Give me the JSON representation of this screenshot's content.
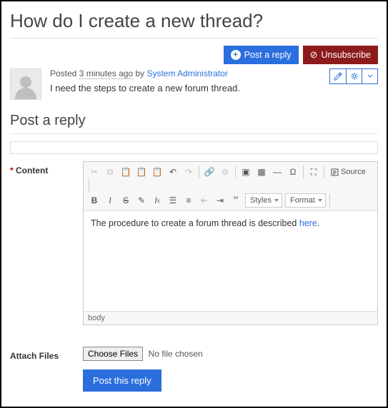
{
  "title": "How do I create a new thread?",
  "actions": {
    "post_reply": "Post a reply",
    "unsubscribe": "Unsubscribe"
  },
  "post": {
    "meta_prefix": "Posted",
    "timestamp": "3 minutes ago",
    "meta_by": "by",
    "author": "System Administrator",
    "body": "I need the steps to create a new forum thread."
  },
  "reply_section_title": "Post a reply",
  "fields": {
    "content_label": "Content",
    "attach_label": "Attach Files"
  },
  "editor": {
    "styles_label": "Styles",
    "format_label": "Format",
    "source_label": "Source",
    "content_prefix": "The procedure to create a forum thread is described ",
    "content_link": "here",
    "content_suffix": ".",
    "path": "body"
  },
  "file": {
    "button": "Choose Files",
    "status": "No file chosen"
  },
  "submit": "Post this reply"
}
